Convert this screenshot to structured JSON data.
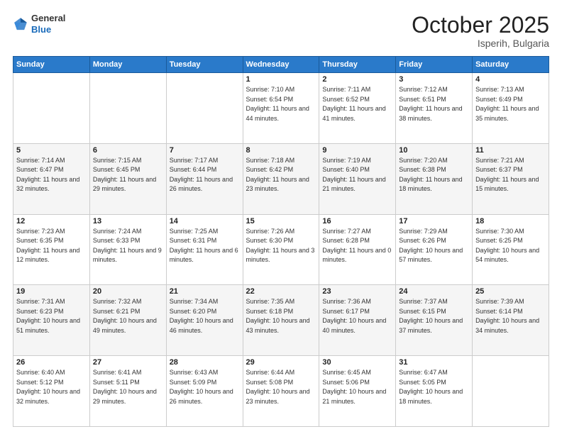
{
  "header": {
    "logo_general": "General",
    "logo_blue": "Blue",
    "month": "October 2025",
    "location": "Isperih, Bulgaria"
  },
  "weekdays": [
    "Sunday",
    "Monday",
    "Tuesday",
    "Wednesday",
    "Thursday",
    "Friday",
    "Saturday"
  ],
  "weeks": [
    [
      {
        "day": "",
        "sunrise": "",
        "sunset": "",
        "daylight": ""
      },
      {
        "day": "",
        "sunrise": "",
        "sunset": "",
        "daylight": ""
      },
      {
        "day": "",
        "sunrise": "",
        "sunset": "",
        "daylight": ""
      },
      {
        "day": "1",
        "sunrise": "Sunrise: 7:10 AM",
        "sunset": "Sunset: 6:54 PM",
        "daylight": "Daylight: 11 hours and 44 minutes."
      },
      {
        "day": "2",
        "sunrise": "Sunrise: 7:11 AM",
        "sunset": "Sunset: 6:52 PM",
        "daylight": "Daylight: 11 hours and 41 minutes."
      },
      {
        "day": "3",
        "sunrise": "Sunrise: 7:12 AM",
        "sunset": "Sunset: 6:51 PM",
        "daylight": "Daylight: 11 hours and 38 minutes."
      },
      {
        "day": "4",
        "sunrise": "Sunrise: 7:13 AM",
        "sunset": "Sunset: 6:49 PM",
        "daylight": "Daylight: 11 hours and 35 minutes."
      }
    ],
    [
      {
        "day": "5",
        "sunrise": "Sunrise: 7:14 AM",
        "sunset": "Sunset: 6:47 PM",
        "daylight": "Daylight: 11 hours and 32 minutes."
      },
      {
        "day": "6",
        "sunrise": "Sunrise: 7:15 AM",
        "sunset": "Sunset: 6:45 PM",
        "daylight": "Daylight: 11 hours and 29 minutes."
      },
      {
        "day": "7",
        "sunrise": "Sunrise: 7:17 AM",
        "sunset": "Sunset: 6:44 PM",
        "daylight": "Daylight: 11 hours and 26 minutes."
      },
      {
        "day": "8",
        "sunrise": "Sunrise: 7:18 AM",
        "sunset": "Sunset: 6:42 PM",
        "daylight": "Daylight: 11 hours and 23 minutes."
      },
      {
        "day": "9",
        "sunrise": "Sunrise: 7:19 AM",
        "sunset": "Sunset: 6:40 PM",
        "daylight": "Daylight: 11 hours and 21 minutes."
      },
      {
        "day": "10",
        "sunrise": "Sunrise: 7:20 AM",
        "sunset": "Sunset: 6:38 PM",
        "daylight": "Daylight: 11 hours and 18 minutes."
      },
      {
        "day": "11",
        "sunrise": "Sunrise: 7:21 AM",
        "sunset": "Sunset: 6:37 PM",
        "daylight": "Daylight: 11 hours and 15 minutes."
      }
    ],
    [
      {
        "day": "12",
        "sunrise": "Sunrise: 7:23 AM",
        "sunset": "Sunset: 6:35 PM",
        "daylight": "Daylight: 11 hours and 12 minutes."
      },
      {
        "day": "13",
        "sunrise": "Sunrise: 7:24 AM",
        "sunset": "Sunset: 6:33 PM",
        "daylight": "Daylight: 11 hours and 9 minutes."
      },
      {
        "day": "14",
        "sunrise": "Sunrise: 7:25 AM",
        "sunset": "Sunset: 6:31 PM",
        "daylight": "Daylight: 11 hours and 6 minutes."
      },
      {
        "day": "15",
        "sunrise": "Sunrise: 7:26 AM",
        "sunset": "Sunset: 6:30 PM",
        "daylight": "Daylight: 11 hours and 3 minutes."
      },
      {
        "day": "16",
        "sunrise": "Sunrise: 7:27 AM",
        "sunset": "Sunset: 6:28 PM",
        "daylight": "Daylight: 11 hours and 0 minutes."
      },
      {
        "day": "17",
        "sunrise": "Sunrise: 7:29 AM",
        "sunset": "Sunset: 6:26 PM",
        "daylight": "Daylight: 10 hours and 57 minutes."
      },
      {
        "day": "18",
        "sunrise": "Sunrise: 7:30 AM",
        "sunset": "Sunset: 6:25 PM",
        "daylight": "Daylight: 10 hours and 54 minutes."
      }
    ],
    [
      {
        "day": "19",
        "sunrise": "Sunrise: 7:31 AM",
        "sunset": "Sunset: 6:23 PM",
        "daylight": "Daylight: 10 hours and 51 minutes."
      },
      {
        "day": "20",
        "sunrise": "Sunrise: 7:32 AM",
        "sunset": "Sunset: 6:21 PM",
        "daylight": "Daylight: 10 hours and 49 minutes."
      },
      {
        "day": "21",
        "sunrise": "Sunrise: 7:34 AM",
        "sunset": "Sunset: 6:20 PM",
        "daylight": "Daylight: 10 hours and 46 minutes."
      },
      {
        "day": "22",
        "sunrise": "Sunrise: 7:35 AM",
        "sunset": "Sunset: 6:18 PM",
        "daylight": "Daylight: 10 hours and 43 minutes."
      },
      {
        "day": "23",
        "sunrise": "Sunrise: 7:36 AM",
        "sunset": "Sunset: 6:17 PM",
        "daylight": "Daylight: 10 hours and 40 minutes."
      },
      {
        "day": "24",
        "sunrise": "Sunrise: 7:37 AM",
        "sunset": "Sunset: 6:15 PM",
        "daylight": "Daylight: 10 hours and 37 minutes."
      },
      {
        "day": "25",
        "sunrise": "Sunrise: 7:39 AM",
        "sunset": "Sunset: 6:14 PM",
        "daylight": "Daylight: 10 hours and 34 minutes."
      }
    ],
    [
      {
        "day": "26",
        "sunrise": "Sunrise: 6:40 AM",
        "sunset": "Sunset: 5:12 PM",
        "daylight": "Daylight: 10 hours and 32 minutes."
      },
      {
        "day": "27",
        "sunrise": "Sunrise: 6:41 AM",
        "sunset": "Sunset: 5:11 PM",
        "daylight": "Daylight: 10 hours and 29 minutes."
      },
      {
        "day": "28",
        "sunrise": "Sunrise: 6:43 AM",
        "sunset": "Sunset: 5:09 PM",
        "daylight": "Daylight: 10 hours and 26 minutes."
      },
      {
        "day": "29",
        "sunrise": "Sunrise: 6:44 AM",
        "sunset": "Sunset: 5:08 PM",
        "daylight": "Daylight: 10 hours and 23 minutes."
      },
      {
        "day": "30",
        "sunrise": "Sunrise: 6:45 AM",
        "sunset": "Sunset: 5:06 PM",
        "daylight": "Daylight: 10 hours and 21 minutes."
      },
      {
        "day": "31",
        "sunrise": "Sunrise: 6:47 AM",
        "sunset": "Sunset: 5:05 PM",
        "daylight": "Daylight: 10 hours and 18 minutes."
      },
      {
        "day": "",
        "sunrise": "",
        "sunset": "",
        "daylight": ""
      }
    ]
  ]
}
